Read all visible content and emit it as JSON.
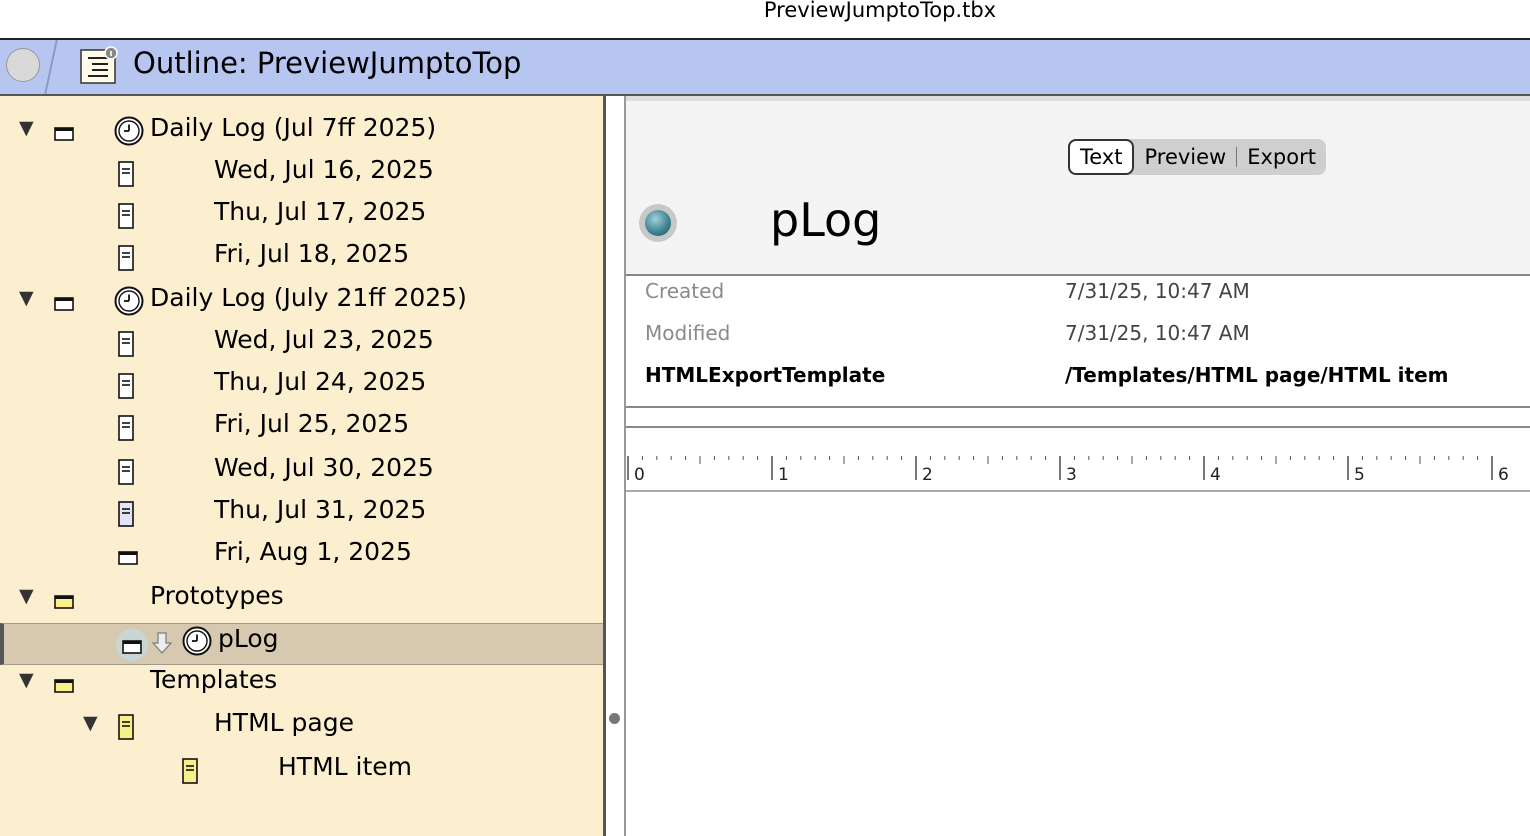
{
  "window": {
    "title": "PreviewJumptoTop.tbx"
  },
  "header": {
    "title": "Outline: PreviewJumptoTop"
  },
  "outline": [
    {
      "label": "Daily Log (Jul 7ff 2025)",
      "level": 0,
      "expanded": true,
      "kind": "container-white",
      "clock": true
    },
    {
      "label": "Wed, Jul 16, 2025",
      "level": 1,
      "kind": "note-white"
    },
    {
      "label": "Thu, Jul 17, 2025",
      "level": 1,
      "kind": "note-white"
    },
    {
      "label": "Fri, Jul 18, 2025",
      "level": 1,
      "kind": "note-white"
    },
    {
      "label": "Daily Log (July 21ff 2025)",
      "level": 0,
      "expanded": true,
      "kind": "container-white",
      "clock": true
    },
    {
      "label": "Wed, Jul 23, 2025",
      "level": 1,
      "kind": "note-white"
    },
    {
      "label": "Thu, Jul 24, 2025",
      "level": 1,
      "kind": "note-white"
    },
    {
      "label": "Fri, Jul 25, 2025",
      "level": 1,
      "kind": "note-white"
    },
    {
      "label": "Wed, Jul 30, 2025",
      "level": 1,
      "kind": "note-white"
    },
    {
      "label": "Thu, Jul 31, 2025",
      "level": 1,
      "kind": "note-lavender"
    },
    {
      "label": "Fri, Aug 1, 2025",
      "level": 1,
      "kind": "container-white"
    },
    {
      "label": "Prototypes",
      "level": 0,
      "expanded": true,
      "kind": "container-yellow"
    },
    {
      "label": "pLog",
      "level": 1,
      "kind": "container-white",
      "selected": true,
      "clock": true,
      "prototype": true
    },
    {
      "label": "Templates",
      "level": 0,
      "expanded": true,
      "kind": "container-yellow"
    },
    {
      "label": "HTML page",
      "level": 1,
      "expanded": true,
      "kind": "note-yellow"
    },
    {
      "label": "HTML item",
      "level": 2,
      "kind": "note-yellow"
    }
  ],
  "tabs": [
    "Text",
    "Preview",
    "Export"
  ],
  "note": {
    "name": "pLog",
    "badge_color": "#3b7f8e"
  },
  "attributes": [
    {
      "label": "Created",
      "value": "7/31/25, 10:47 AM",
      "bold": false
    },
    {
      "label": "Modified",
      "value": "7/31/25, 10:47 AM",
      "bold": false
    },
    {
      "label": "HTMLExportTemplate",
      "value": "/Templates/HTML page/HTML item",
      "bold": true
    }
  ],
  "ruler": [
    "0",
    "1",
    "2",
    "3",
    "4",
    "5",
    "6"
  ],
  "colors": {
    "outline_bg": "#fcefd0",
    "header_bg": "#b6c6f0",
    "selected_row": "#d6c9b0"
  }
}
